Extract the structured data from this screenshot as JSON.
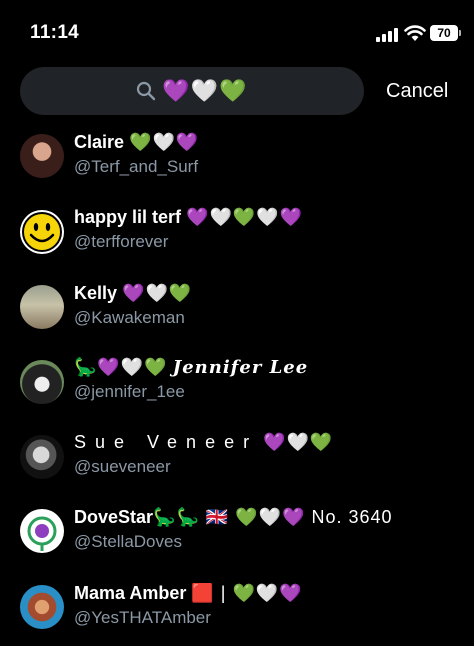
{
  "status_bar": {
    "time": "11:14",
    "battery": "70"
  },
  "search": {
    "query": "💜🤍💚",
    "cancel_label": "Cancel"
  },
  "results": [
    {
      "name": "Claire",
      "name_extra": "💚🤍💜",
      "handle": "@Terf_and_Surf"
    },
    {
      "name": "happy lil terf",
      "name_extra": "💜🤍💚🤍💜",
      "handle": "@terfforever"
    },
    {
      "name": "Kelly",
      "name_extra": "💜🤍💚",
      "handle": "@Kawakeman"
    },
    {
      "name_prefix": "🦕💜🤍💚",
      "name": "𝑱𝒆𝒏𝒏𝒊𝒇𝒆𝒓 𝑳𝒆𝒆",
      "handle": "@jennifer_1ee"
    },
    {
      "name": "Sue Veneer",
      "name_extra": "💜🤍💚",
      "handle": "@sueveneer"
    },
    {
      "name": "DoveStar",
      "name_extra": "🦕🦕 🇬🇧 💚🤍💜 No. 3640",
      "handle": "@StellaDoves"
    },
    {
      "name": "Mama Amber",
      "name_extra": "🟥 | 💚🤍💜",
      "handle": "@YesTHATAmber"
    }
  ]
}
